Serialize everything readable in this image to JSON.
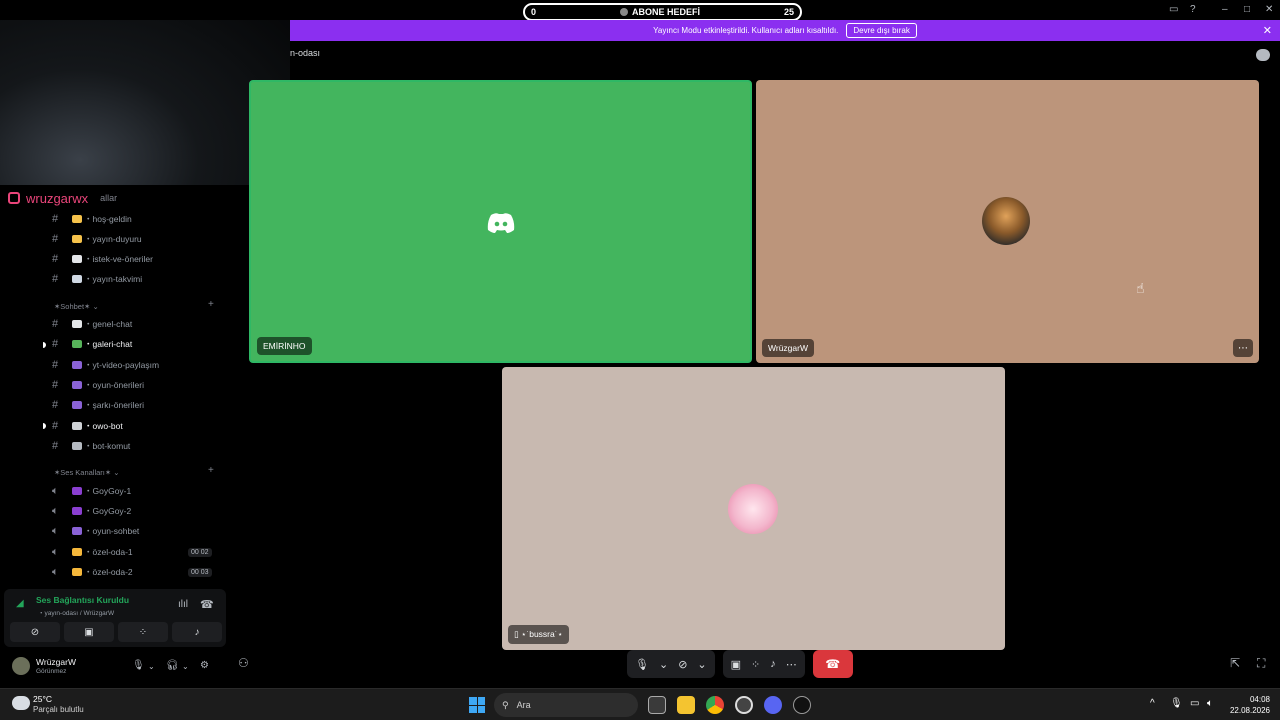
{
  "goal": {
    "start": "0",
    "title": "ABONE HEDEFİ",
    "end": "25"
  },
  "banner": {
    "text": "Yayıncı Modu etkinleştirildi. Kullanıcı adları kısaltıldı.",
    "button": "Devre dışı bırak",
    "close": "✕"
  },
  "header": {
    "channel": "n-odası"
  },
  "instagram": {
    "handle": "wruzgarwx",
    "rest": "allar"
  },
  "sidebar": {
    "channels": [
      {
        "label": "・hoş-geldin",
        "emoji": "wave",
        "color": "#f5c24b"
      },
      {
        "label": "・yayın-duyuru",
        "emoji": "bell",
        "color": "#f5c24b"
      },
      {
        "label": "・istek-ve-öneriler",
        "emoji": "memo",
        "color": "#e3e5e8"
      },
      {
        "label": "・yayın-takvimi",
        "emoji": "calendar",
        "color": "#cfd8e3"
      }
    ],
    "cat_sohbet": "✶Sohbet✶",
    "chat_channels": [
      {
        "label": "・genel-chat",
        "emoji": "speech",
        "color": "#e3e5e8",
        "active": false
      },
      {
        "label": "・galeri-chat",
        "emoji": "image",
        "color": "#57b45a",
        "active": true
      },
      {
        "label": "・yt-video-paylaşım",
        "emoji": "tv",
        "color": "#8a62d6",
        "active": false
      },
      {
        "label": "・oyun-önerileri",
        "emoji": "controller",
        "color": "#8a62d6",
        "active": false
      },
      {
        "label": "・şarkı-önerileri",
        "emoji": "sparkles",
        "color": "#8a62d6",
        "active": false
      },
      {
        "label": "・owo-bot",
        "emoji": "dice",
        "color": "#cfd2d6",
        "active": true
      },
      {
        "label": "・bot-komut",
        "emoji": "tools",
        "color": "#b5bac1",
        "active": false
      }
    ],
    "cat_ses": "✶Ses Kanalları✶",
    "voice_channels": [
      {
        "label": "・GoyGoy-1",
        "emoji": "purple-heart",
        "color": "#8a3fd1",
        "limit": ""
      },
      {
        "label": "・GoyGoy-2",
        "emoji": "purple-heart",
        "color": "#8a3fd1",
        "limit": ""
      },
      {
        "label": "・oyun-sohbet",
        "emoji": "controller",
        "color": "#8a62d6",
        "limit": ""
      },
      {
        "label": "・özel-oda-1",
        "emoji": "lock",
        "color": "#f5b73b",
        "limit": "00 02"
      },
      {
        "label": "・özel-oda-2",
        "emoji": "lock",
        "color": "#f5b73b",
        "limit": "00 03"
      }
    ]
  },
  "voice_panel": {
    "status": "Ses Bağlantısı Kuruldu",
    "sub": "・yayın-odası / WrüzgarW"
  },
  "user": {
    "name": "WrüzgarW",
    "status": "Görünmez"
  },
  "tiles": [
    {
      "name": "EMİRİNHO"
    },
    {
      "name": "WrüzgarW"
    },
    {
      "name": "⋆˙bussra˙⋆"
    }
  ],
  "taskbar": {
    "temp": "25°C",
    "weather": "Parçalı bulutlu",
    "search": "Ara",
    "time": "04:08",
    "date": "22.08.2026"
  }
}
